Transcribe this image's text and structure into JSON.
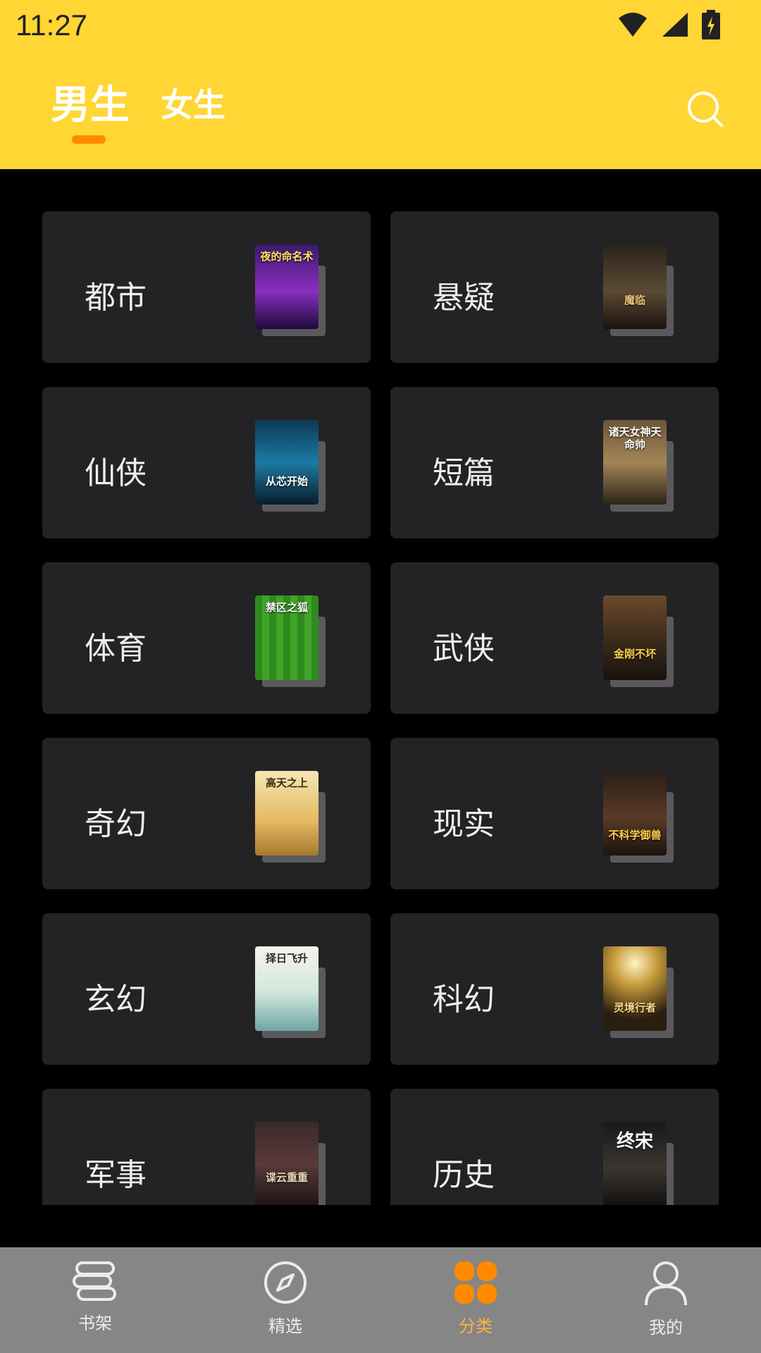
{
  "status_bar": {
    "time": "11:27"
  },
  "header": {
    "tabs": [
      {
        "label": "男生"
      },
      {
        "label": "女生"
      }
    ],
    "search_icon": "search-icon",
    "accent": "#ff8a00",
    "background": "#ffd634"
  },
  "categories": [
    {
      "label": "都市",
      "cover_title": "夜的命名术"
    },
    {
      "label": "悬疑",
      "cover_title": "魔临"
    },
    {
      "label": "仙侠",
      "cover_title": "从芯开始"
    },
    {
      "label": "短篇",
      "cover_title": "诸天女神天命帅"
    },
    {
      "label": "体育",
      "cover_title": "禁区之狐"
    },
    {
      "label": "武侠",
      "cover_title": "金刚不坏"
    },
    {
      "label": "奇幻",
      "cover_title": "高天之上"
    },
    {
      "label": "现实",
      "cover_title": "不科学御兽"
    },
    {
      "label": "玄幻",
      "cover_title": "择日飞升"
    },
    {
      "label": "科幻",
      "cover_title": "灵境行者"
    },
    {
      "label": "军事",
      "cover_title": "谍云重重"
    },
    {
      "label": "历史",
      "cover_title": "终宋"
    }
  ],
  "bottom_nav": {
    "items": [
      {
        "label": "书架",
        "icon": "bookshelf-icon"
      },
      {
        "label": "精选",
        "icon": "compass-icon"
      },
      {
        "label": "分类",
        "icon": "category-icon",
        "active": true
      },
      {
        "label": "我的",
        "icon": "profile-icon"
      }
    ],
    "active_color": "#ffb23c"
  }
}
